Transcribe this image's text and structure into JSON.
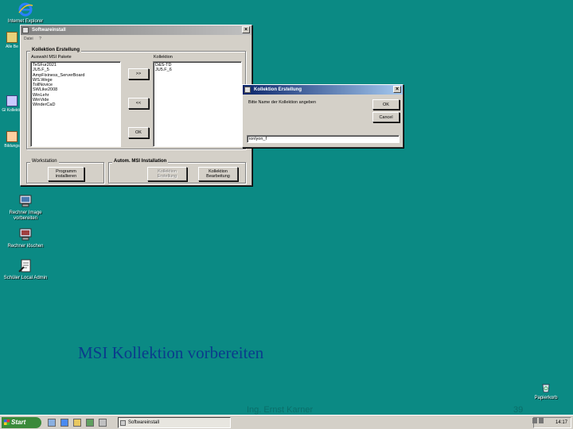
{
  "desktop": {
    "icons": [
      {
        "label": "Internet Explorer"
      },
      {
        "label": "Rechner Image vorbereiten"
      },
      {
        "label": "Rechner löschen"
      },
      {
        "label": "Schüler Local Admin"
      }
    ],
    "side_icons": [
      {
        "label": "Alle Be"
      },
      {
        "label": "Gl Kollektio"
      },
      {
        "label": "Bildungs"
      }
    ],
    "recycle_label": "Papierkorb"
  },
  "main_window": {
    "title": "Softwareinstall",
    "menu": [
      "Datei",
      "?"
    ],
    "collection_group": {
      "title": "Kollektion Erstellung",
      "left_label": "Auswahl MSI Pakete",
      "right_label": "Kollektion",
      "left_items": [
        "TeSFur2021",
        "JU5.F_5",
        "AmpFixiness_ServerBoard",
        "WS.Wege",
        "TollNovice",
        "SWLike2008",
        "WinLehr",
        "WinVide",
        "WinderCaD"
      ],
      "right_items": [
        "D&S-TD",
        "JU5.F_6"
      ],
      "add_btn": ">>",
      "remove_btn": "<<",
      "ok_btn": "OK"
    },
    "workstation_group": {
      "title": "Workstation",
      "btn": "Programm installieren"
    },
    "auto_group": {
      "title": "Autom. MSI Installation",
      "btn_create": "Kollektion Erstellung",
      "btn_edit": "Kollektion Bearbeitung"
    }
  },
  "dialog": {
    "title": "Kollektion Erstellung",
    "prompt": "Bitte Name der Kollektion angeben",
    "ok": "OK",
    "cancel": "Cancel",
    "input_value": "ionlyon_f"
  },
  "slide": {
    "title": "MSI Kollektion vorbereiten",
    "author": "Ing. Ernst Karner",
    "page": "39"
  },
  "taskbar": {
    "start": "Start",
    "task": "Softwareinstall",
    "clock": "14:17"
  }
}
